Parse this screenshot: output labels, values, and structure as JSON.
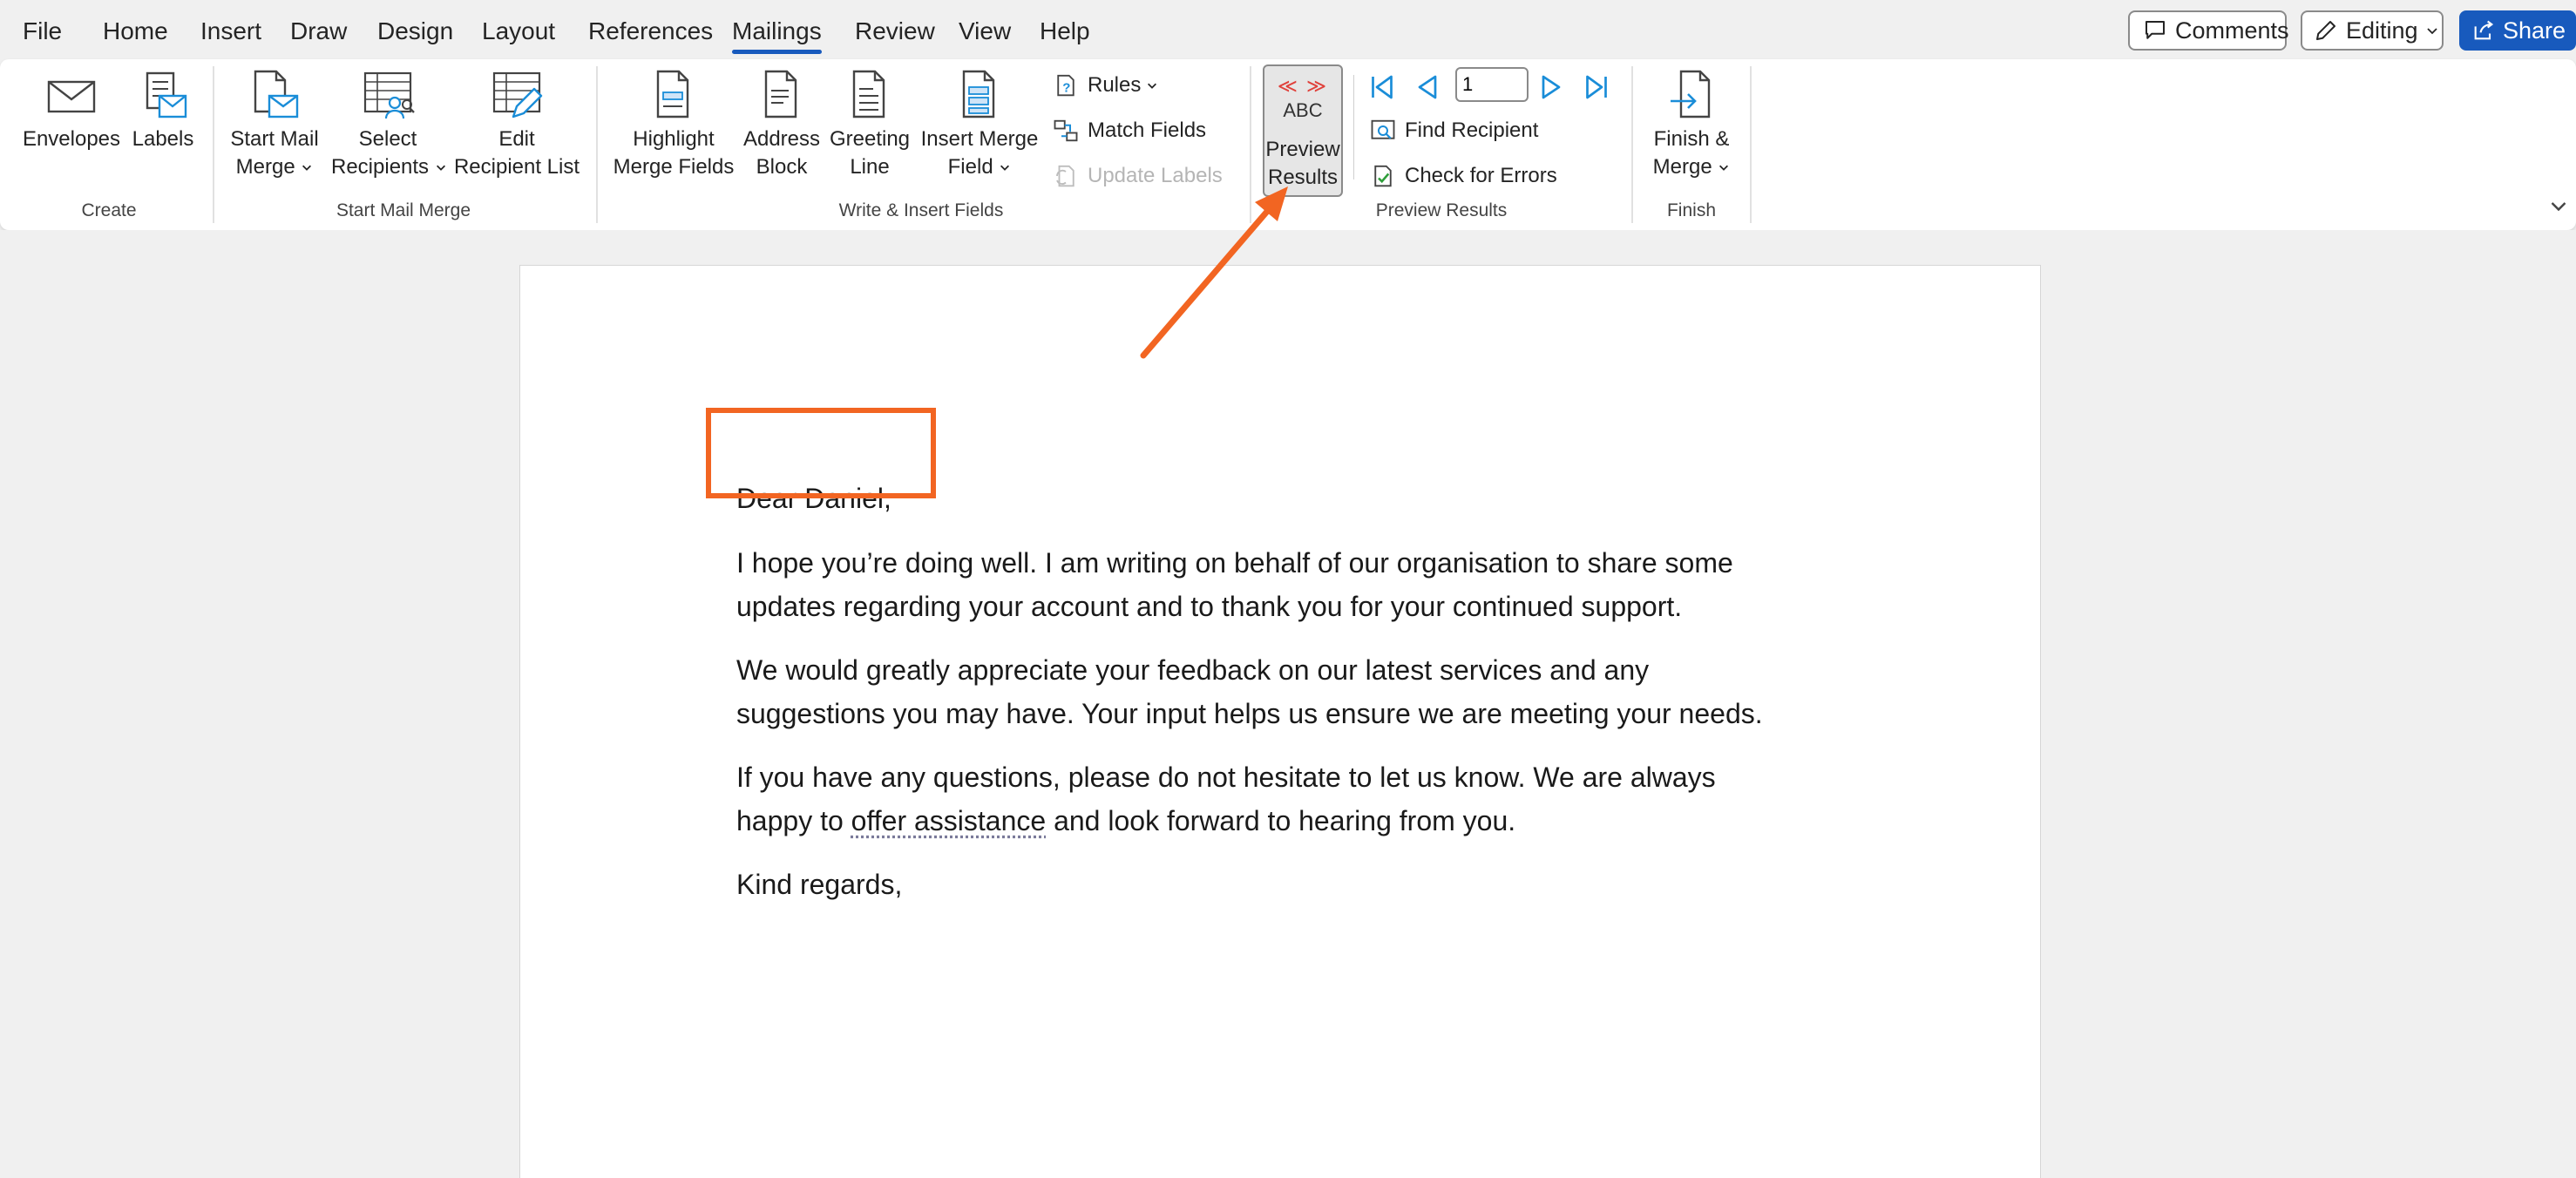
{
  "tabs": [
    "File",
    "Home",
    "Insert",
    "Draw",
    "Design",
    "Layout",
    "References",
    "Mailings",
    "Review",
    "View",
    "Help"
  ],
  "active_tab": "Mailings",
  "top_right": {
    "comments": "Comments",
    "editing": "Editing",
    "share": "Share"
  },
  "ribbon": {
    "create": {
      "label": "Create",
      "envelopes": "Envelopes",
      "labels": "Labels"
    },
    "start_mail_merge": {
      "label": "Start Mail Merge",
      "start_line1": "Start Mail",
      "start_line2": "Merge",
      "select_line1": "Select",
      "select_line2": "Recipients",
      "edit_line1": "Edit",
      "edit_line2": "Recipient List"
    },
    "write_insert": {
      "label": "Write & Insert Fields",
      "highlight_line1": "Highlight",
      "highlight_line2": "Merge Fields",
      "address_line1": "Address",
      "address_line2": "Block",
      "greeting_line1": "Greeting",
      "greeting_line2": "Line",
      "insert_line1": "Insert Merge",
      "insert_line2": "Field",
      "rules": "Rules",
      "match_fields": "Match Fields",
      "update_labels": "Update Labels"
    },
    "preview": {
      "label": "Preview Results",
      "preview_line1": "Preview",
      "preview_line2": "Results",
      "abc": "ABC",
      "chevrons": "≪ ≫",
      "record": "1",
      "find_recipient": "Find Recipient",
      "check_errors": "Check for Errors"
    },
    "finish": {
      "label": "Finish",
      "finish_line1": "Finish &",
      "finish_line2": "Merge"
    }
  },
  "document": {
    "salutation": "Dear Daniel,",
    "p1_line1": "I hope you’re doing well. I am writing on behalf of our organisation to share some",
    "p1_line2": "updates regarding your account and to thank you for your continued support.",
    "p2_line1": "We would greatly appreciate your feedback on our latest services and any",
    "p2_line2": "suggestions you may have. Your input helps us ensure we are meeting your needs.",
    "p3_line1": "If you have any questions, please do not hesitate to let us know. We are always",
    "p3_line2_a": "happy to ",
    "p3_line2_b": "offer assistance",
    "p3_line2_c": " and look forward to hearing from you.",
    "closing": "Kind regards,"
  },
  "colors": {
    "accent": "#185abd",
    "annotation": "#f26522"
  }
}
